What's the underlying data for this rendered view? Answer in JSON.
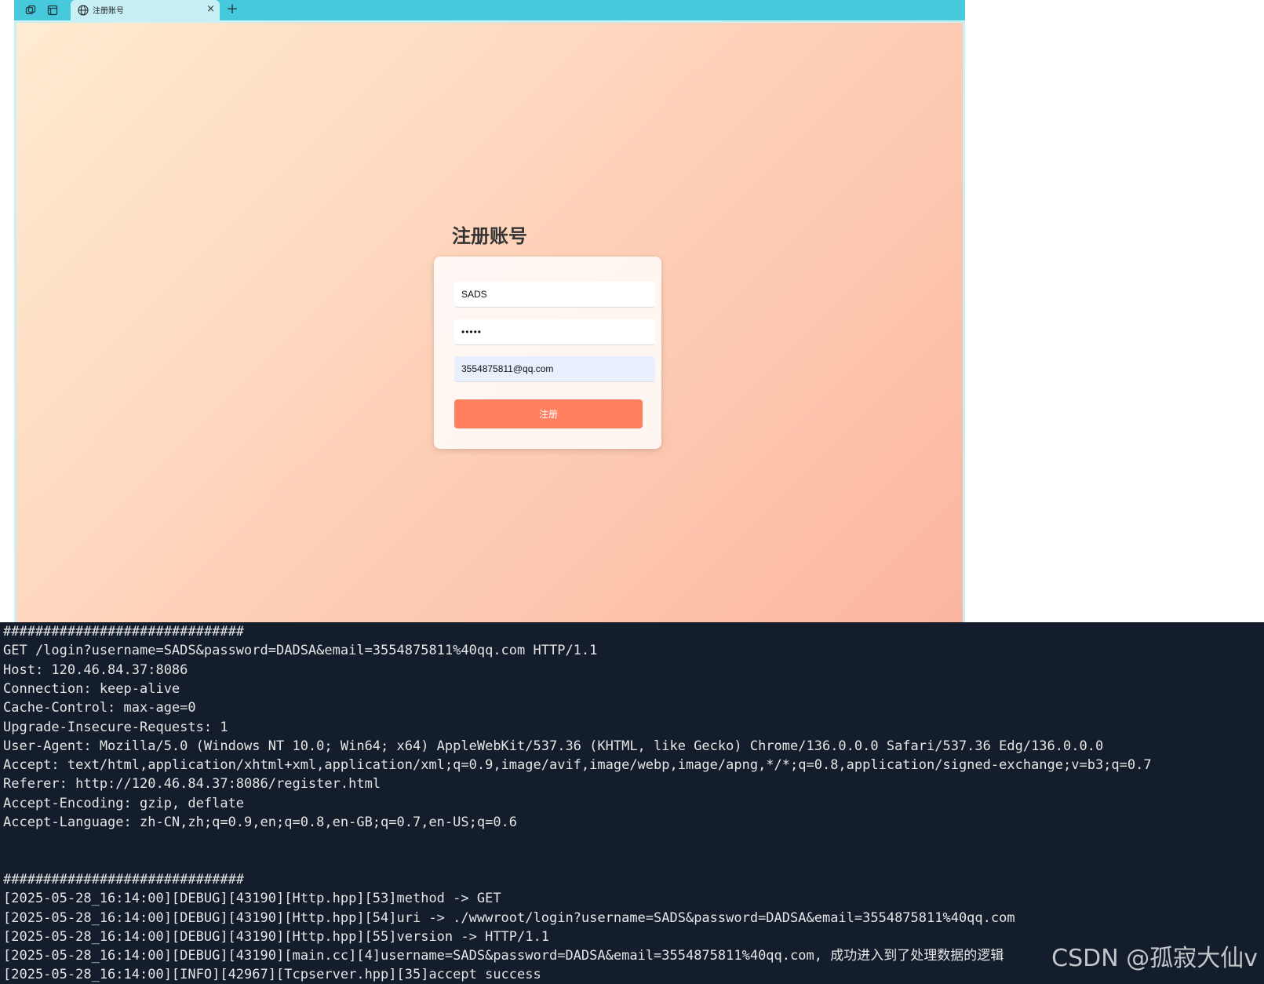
{
  "browser": {
    "tab": {
      "title": "注册账号",
      "close_label": "×"
    },
    "new_tab_label": "+",
    "colors": {
      "tabbar": "#46c9da",
      "active_tab": "#c6f0f6"
    }
  },
  "page": {
    "title": "注册账号",
    "username_value": "SADS",
    "password_value": "•••••",
    "email_value": "3554875811@qq.com",
    "submit_label": "注册",
    "colors": {
      "gradient_start": "#ffecd2",
      "gradient_end": "#fcb69f",
      "button": "#ff7f5e"
    }
  },
  "terminal": {
    "lines": [
      "##############################",
      "GET /login?username=SADS&password=DADSA&email=3554875811%40qq.com HTTP/1.1",
      "Host: 120.46.84.37:8086",
      "Connection: keep-alive",
      "Cache-Control: max-age=0",
      "Upgrade-Insecure-Requests: 1",
      "User-Agent: Mozilla/5.0 (Windows NT 10.0; Win64; x64) AppleWebKit/537.36 (KHTML, like Gecko) Chrome/136.0.0.0 Safari/537.36 Edg/136.0.0.0",
      "Accept: text/html,application/xhtml+xml,application/xml;q=0.9,image/avif,image/webp,image/apng,*/*;q=0.8,application/signed-exchange;v=b3;q=0.7",
      "Referer: http://120.46.84.37:8086/register.html",
      "Accept-Encoding: gzip, deflate",
      "Accept-Language: zh-CN,zh;q=0.9,en;q=0.8,en-GB;q=0.7,en-US;q=0.6",
      "",
      "",
      "##############################",
      "[2025-05-28_16:14:00][DEBUG][43190][Http.hpp][53]method -> GET",
      "[2025-05-28_16:14:00][DEBUG][43190][Http.hpp][54]uri -> ./wwwroot/login?username=SADS&password=DADSA&email=3554875811%40qq.com",
      "[2025-05-28_16:14:00][DEBUG][43190][Http.hpp][55]version -> HTTP/1.1",
      "[2025-05-28_16:14:00][DEBUG][43190][main.cc][4]username=SADS&password=DADSA&email=3554875811%40qq.com, 成功进入到了处理数据的逻辑",
      "[2025-05-28_16:14:00][INFO][42967][Tcpserver.hpp][35]accept success"
    ],
    "colors": {
      "background": "#131d2b",
      "text": "#e6e6e6"
    }
  },
  "watermark": "CSDN @孤寂大仙v"
}
